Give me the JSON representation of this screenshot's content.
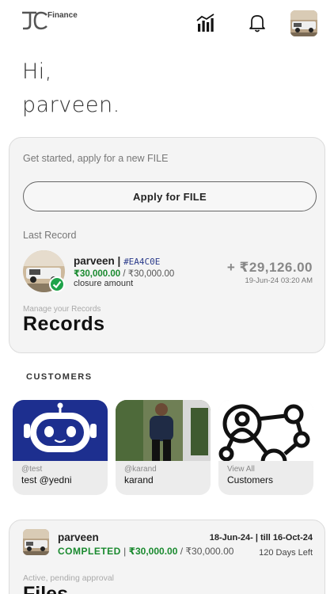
{
  "header": {
    "logo_text": "Finance",
    "icons": [
      "logo-icon",
      "chart-icon",
      "bell-icon",
      "avatar"
    ]
  },
  "greeting": {
    "line1": "Hi,",
    "line2": "parveen."
  },
  "main_card": {
    "get_started": "Get started, apply for a new FILE",
    "apply_button": "Apply for FILE",
    "last_record_label": "Last Record",
    "record": {
      "name": "parveen | ",
      "id": "#EA4C0E",
      "amount_paid": "₹30,000.00",
      "amount_sep": " / ",
      "amount_total": "₹30,000.00",
      "subtitle": "closure amount",
      "total": "+ ₹29,126.00",
      "date": "19-Jun-24 03:20 AM"
    },
    "manage_label": "Manage your Records",
    "records_title": "Records"
  },
  "customers": {
    "label": "CUSTOMERS",
    "items": [
      {
        "handle": "@test",
        "name": "test @yedni"
      },
      {
        "handle": "@karand",
        "name": "karand"
      },
      {
        "handle": "View All",
        "name": "Customers"
      }
    ]
  },
  "file_card": {
    "name": "parveen",
    "status": "COMPLETED",
    "status_sep": " | ",
    "amount_paid": "₹30,000.00",
    "amount_sep": " / ",
    "amount_total": "₹30,000.00",
    "dates": "18-Jun-24- | till 16-Oct-24",
    "days_left": "120 Days Left",
    "sub_label": "Active, pending approval",
    "title": "Files"
  },
  "colors": {
    "accent_green": "#1a8a2f",
    "robot_blue": "#1d2f8f",
    "id_blue": "#2a3a8a"
  }
}
